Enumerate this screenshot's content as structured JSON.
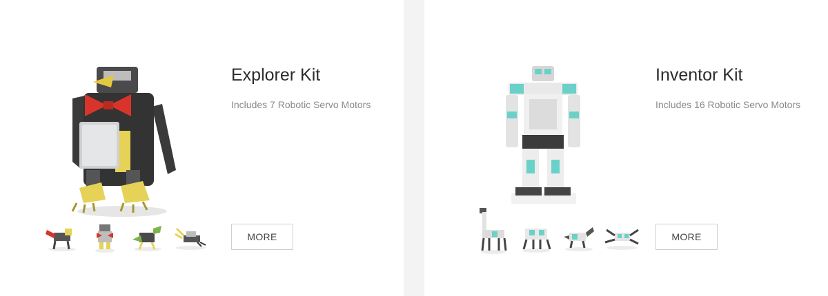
{
  "products": [
    {
      "title": "Explorer Kit",
      "subtitle": "Includes 7 Robotic Servo Motors",
      "more_label": "MORE",
      "hero_icon": "penguin-robot-image",
      "thumbnails": [
        "robot-dog-thumb",
        "robot-humanoid-thumb",
        "robot-dino-thumb",
        "robot-scorpion-thumb"
      ]
    },
    {
      "title": "Inventor Kit",
      "subtitle": "Includes 16 Robotic Servo Motors",
      "more_label": "MORE",
      "hero_icon": "humanoid-robot-image",
      "thumbnails": [
        "robot-giraffe-thumb",
        "robot-walker-thumb",
        "robot-dino-thumb",
        "robot-spider-thumb"
      ]
    }
  ],
  "colors": {
    "divider": "#f3f3f3",
    "title": "#2b2b2b",
    "subtitle": "#8a8a8a",
    "button_border": "#cfcfcf",
    "explorer_accent": "#d9342b",
    "explorer_yellow": "#e6d257",
    "inventor_accent": "#6ad1c8"
  }
}
